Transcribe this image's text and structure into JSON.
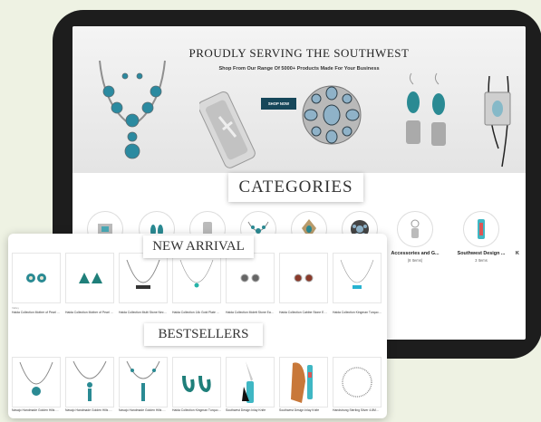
{
  "hero": {
    "title": "PROUDLY SERVING THE SOUTHWEST",
    "subtitle": "Shop From Our Range Of 5000+ Products Made For Your Business",
    "button": "SHOP NOW"
  },
  "categories": {
    "title": "CATEGORIES",
    "items": [
      {
        "label": "",
        "count": ""
      },
      {
        "label": "",
        "count": ""
      },
      {
        "label": "",
        "count": ""
      },
      {
        "label": "",
        "count": ""
      },
      {
        "label": "",
        "count": ""
      },
      {
        "label": "",
        "count": ""
      },
      {
        "label": "Accessories and G...",
        "count": "(8 Items)"
      },
      {
        "label": "Southwest Design ...",
        "count": "3 Items"
      },
      {
        "label": "K",
        "count": ""
      }
    ]
  },
  "new_arrival": {
    "title": "NEW ARRIVAL",
    "products": [
      {
        "brand": "Valley",
        "name": "Haida Collection Mother of Pearl & T..."
      },
      {
        "brand": "",
        "name": "Haida Collection Mother of Pearl & T..."
      },
      {
        "brand": "",
        "name": "Haida Collection Multi Stone Necklace"
      },
      {
        "brand": "",
        "name": "Haida Collection 14k Gold Plate Kin..."
      },
      {
        "brand": "",
        "name": "Haida Collection Molett Stone Earrings"
      },
      {
        "brand": "",
        "name": "Haida Collection Cabibe Stone Earrings"
      },
      {
        "brand": "",
        "name": "Haida Collection Kingman Turquoise..."
      }
    ]
  },
  "bestsellers": {
    "title": "BESTSELLERS",
    "products": [
      {
        "name": "Navajo Handmade Golden Hills Nec..."
      },
      {
        "name": "Navajo Handmade Golden Hills Nec..."
      },
      {
        "name": "Navajo Handmade Golden Hills Nec..."
      },
      {
        "name": "Haida Collection Kingman Turquoise..."
      },
      {
        "name": "Southwest Design Inlay Knife"
      },
      {
        "name": "Southwest Design Inlay Knife"
      },
      {
        "name": "Handstrung Sterling Silver 4.8MM ..."
      }
    ]
  },
  "colors": {
    "accent": "#16475a",
    "turquoise": "#2aa7b4",
    "background": "#eef2e3"
  }
}
